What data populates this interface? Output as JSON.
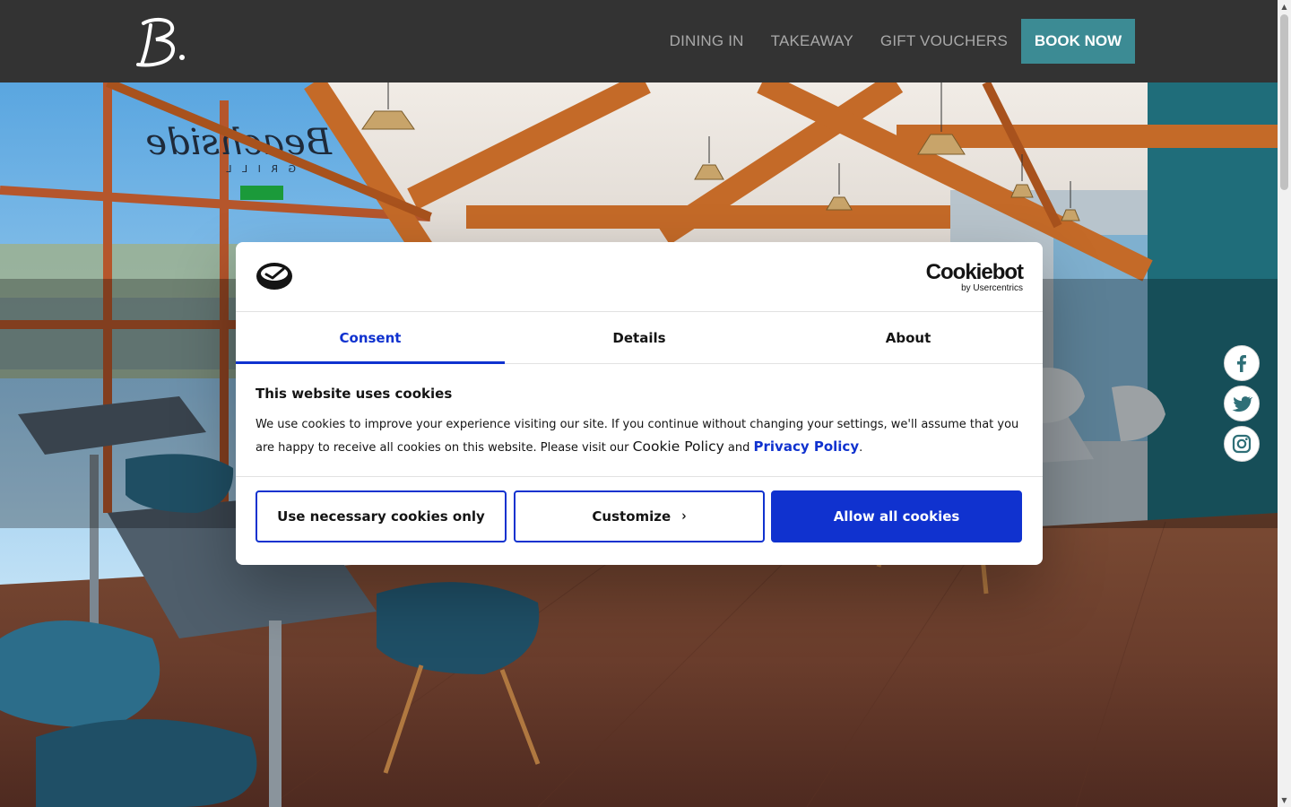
{
  "nav": {
    "logo_alt": "B.",
    "links": [
      "DINING IN",
      "TAKEAWAY",
      "GIFT VOUCHERS"
    ],
    "book_label": "BOOK NOW",
    "accent": "#3c8b94",
    "background": "#333333"
  },
  "hero": {
    "window_sign": "Beachside",
    "window_sign_sub": "G R I L L"
  },
  "social": {
    "items": [
      "facebook-icon",
      "twitter-icon",
      "instagram-icon"
    ],
    "color": "#2f6f77"
  },
  "cookie": {
    "brand_name": "Cookiebot",
    "brand_sub": "by Usercentrics",
    "tabs": [
      "Consent",
      "Details",
      "About"
    ],
    "active_tab": "Consent",
    "title": "This website uses cookies",
    "text_before": "We use cookies to improve your experience visiting our site. If you continue without changing your settings, we'll assume that you are happy to receive all cookies on this website. Please visit our ",
    "cookie_policy": "Cookie Policy",
    "text_and": " and ",
    "privacy_policy": "Privacy Policy",
    "text_end": ".",
    "buttons": {
      "necessary": "Use necessary cookies only",
      "customize": "Customize",
      "allow_all": "Allow all cookies"
    },
    "accent": "#1032cf"
  }
}
